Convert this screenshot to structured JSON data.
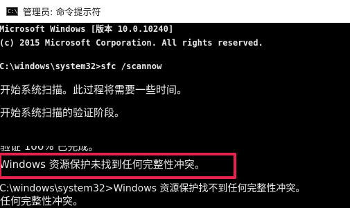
{
  "window": {
    "title": "管理员: 命令提示符",
    "icon": "cmd-console-icon",
    "icon_text": "C:\\"
  },
  "console": {
    "lines": [
      "Microsoft Windows [版本 10.0.10240]",
      "(c) 2015 Microsoft Corporation. All rights reserved.",
      "C:\\windows\\system32>sfc /scannow",
      "开始系统扫描。此过程将需要一些时间。",
      "开始系统扫描的验证阶段。",
      "验证 100% 已完成。",
      "Windows 资源保护未找到任何完整性冲突。",
      "C:\\windows\\system32>Windows 资源保护找不到任何完整性冲突。",
      "任何完整性冲突。"
    ]
  },
  "colors": {
    "console_background": "#000000",
    "console_text": "#e9e9e9",
    "titlebar_background": "#ffffff",
    "highlight_border": "#e8224f"
  }
}
